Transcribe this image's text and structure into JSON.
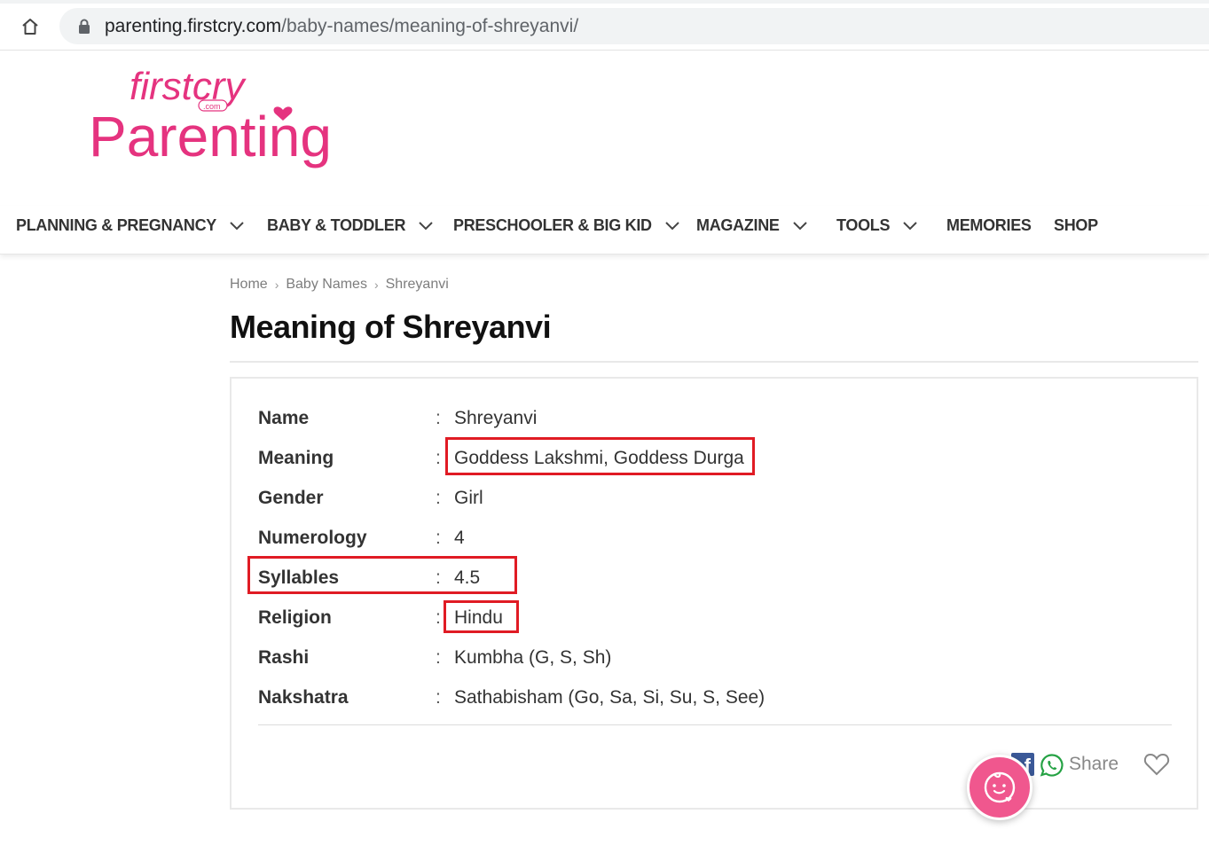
{
  "browser": {
    "url_host": "parenting.firstcry.com",
    "url_path": "/baby-names/meaning-of-shreyanvi/"
  },
  "logo": {
    "brand_top": "firstcry",
    "brand_com": ".com",
    "brand_main": "Parenting",
    "color": "#e5337f"
  },
  "nav": {
    "items": [
      {
        "label": "PLANNING & PREGNANCY",
        "dropdown": true
      },
      {
        "label": "BABY & TODDLER",
        "dropdown": true
      },
      {
        "label": "PRESCHOOLER & BIG KID",
        "dropdown": true
      },
      {
        "label": "MAGAZINE",
        "dropdown": true
      },
      {
        "label": "TOOLS",
        "dropdown": true
      },
      {
        "label": "MEMORIES",
        "dropdown": false
      },
      {
        "label": "SHOP",
        "dropdown": false
      }
    ]
  },
  "breadcrumb": {
    "items": [
      "Home",
      "Baby Names",
      "Shreyanvi"
    ],
    "separator": "›"
  },
  "page": {
    "title": "Meaning of Shreyanvi"
  },
  "details": {
    "separator": ":",
    "rows": [
      {
        "label": "Name",
        "value": "Shreyanvi"
      },
      {
        "label": "Meaning",
        "value": "Goddess Lakshmi, Goddess Durga"
      },
      {
        "label": "Gender",
        "value": "Girl"
      },
      {
        "label": "Numerology",
        "value": "4"
      },
      {
        "label": "Syllables",
        "value": "4.5"
      },
      {
        "label": "Religion",
        "value": "Hindu"
      },
      {
        "label": "Rashi",
        "value": "Kumbha (G, S, Sh)"
      },
      {
        "label": "Nakshatra",
        "value": "Sathabisham (Go, Sa, Si, Su, S, See)"
      }
    ]
  },
  "share": {
    "label": "Share",
    "facebook_glyph": "f"
  },
  "colors": {
    "brand_pink": "#e5337f",
    "fab_pink": "#f0578e",
    "highlight_red": "#e01b24",
    "facebook_blue": "#3b5998",
    "whatsapp_green": "#25a244"
  }
}
